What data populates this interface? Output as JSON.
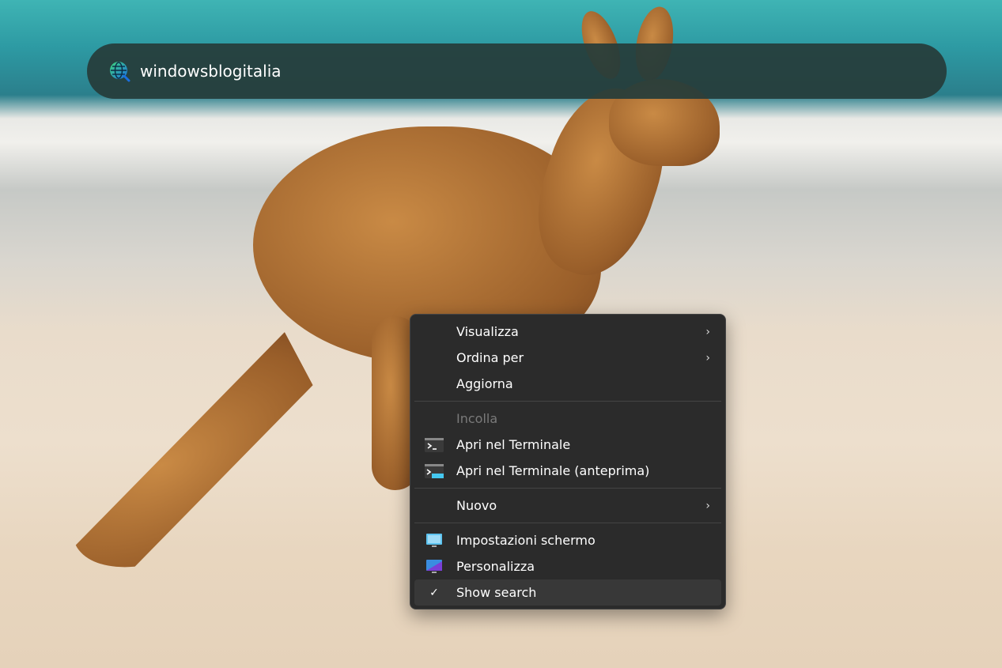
{
  "search": {
    "text": "windowsblogitalia",
    "icon": "globe-search-icon"
  },
  "context_menu": {
    "items": [
      {
        "label": "Visualizza",
        "submenu": true
      },
      {
        "label": "Ordina per",
        "submenu": true
      },
      {
        "label": "Aggiorna"
      },
      {
        "label": "Incolla",
        "disabled": true
      },
      {
        "label": "Apri nel Terminale",
        "icon": "terminal-icon"
      },
      {
        "label": "Apri nel Terminale (anteprima)",
        "icon": "terminal-preview-icon"
      },
      {
        "label": "Nuovo",
        "submenu": true
      },
      {
        "label": "Impostazioni schermo",
        "icon": "display-settings-icon"
      },
      {
        "label": "Personalizza",
        "icon": "personalize-icon"
      },
      {
        "label": "Show search",
        "checked": true,
        "check_glyph": "✓"
      }
    ],
    "chevron": "›"
  }
}
